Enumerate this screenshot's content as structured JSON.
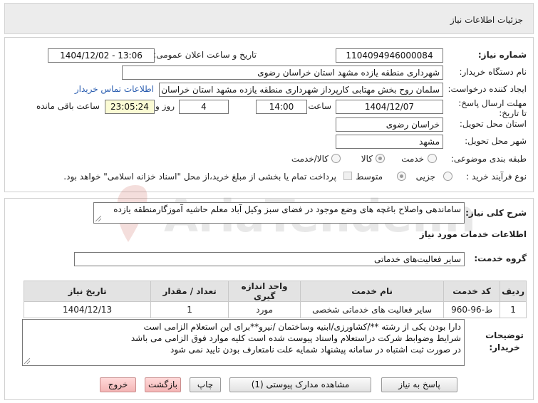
{
  "header": {
    "title": "جزئیات اطلاعات نیاز"
  },
  "fields": {
    "need_number": {
      "label": "شماره نیاز:",
      "value": "1104094946000084"
    },
    "announce_datetime": {
      "label": "تاریخ و ساعت اعلان عمومی:",
      "value": "1404/12/02 - 13:06"
    },
    "buyer_org": {
      "label": "نام دستگاه خریدار:",
      "value": "شهرداری منطقه یازده مشهد استان خراسان رضوی"
    },
    "requester": {
      "label": "ایجاد کننده درخواست:",
      "value": "سلمان روح بخش مهتابی کارپرداز شهرداری منطقه یازده مشهد استان خراسان ر",
      "contact_link": "اطلاعات تماس خریدار"
    },
    "deadline": {
      "label": "مهلت ارسال پاسخ: تا تاریخ:",
      "date": "1404/12/07",
      "time_label": "ساعت",
      "time": "14:00",
      "days": "4",
      "days_label": "روز و",
      "remaining": "23:05:24",
      "remaining_label": "ساعت باقی مانده"
    },
    "delivery_province": {
      "label": "استان محل تحویل:",
      "value": "خراسان رضوی"
    },
    "delivery_city": {
      "label": "شهر محل تحویل:",
      "value": "مشهد"
    },
    "category": {
      "label": "طبقه بندی موضوعی:",
      "options": [
        "کالا",
        "خدمت",
        "کالا/خدمت"
      ],
      "selected": "خدمت"
    },
    "purchase_type": {
      "label": "نوع فرآیند خرید :",
      "options": [
        "جزیی",
        "متوسط"
      ],
      "selected": "متوسط",
      "payment_note": "پرداخت تمام یا بخشی از مبلغ خرید،از محل \"اسناد خزانه اسلامی\" خواهد بود."
    }
  },
  "summary": {
    "label": "شرح کلی نیاز:",
    "value": "ساماندهی واصلاح باغچه های وضع موجود در فضای سبز وکیل آباد معلم حاشیه آموزگارمنطقه یازده"
  },
  "services_section": {
    "title": "اطلاعات خدمات مورد نیاز"
  },
  "service_group": {
    "label": "گروه خدمت:",
    "value": "سایر فعالیت‌های خدماتی"
  },
  "table": {
    "headers": [
      "ردیف",
      "کد خدمت",
      "نام خدمت",
      "واحد اندازه گیری",
      "تعداد / مقدار",
      "تاریخ نیاز"
    ],
    "rows": [
      [
        "1",
        "ط-96-960",
        "سایر فعالیت های خدماتی شخصی",
        "مورد",
        "1",
        "1404/12/13"
      ]
    ]
  },
  "buyer_notes": {
    "label": "توضیحات خریدار:",
    "lines": [
      "دارا بودن یکی از رشته **/کشاورزی/ابنیه وساختمان /نیرو**برای این استعلام الزامی است",
      " شرایط وضوابط شرکت دراستعلام واسناد پیوست شده است کلیه موارد فوق الزامی می باشد",
      "در صورت ثبت اشتباه در سامانه پیشنهاد شمایه علت نامتعارف بودن تایید نمی شود"
    ]
  },
  "buttons": {
    "reply": "پاسخ به نیاز",
    "attachments": "مشاهده مدارک پیوستی (1)",
    "print": "چاپ",
    "back": "بازگشت",
    "exit": "خروج"
  },
  "watermark": {
    "text": "AriaTender.net"
  },
  "colors": {
    "link": "#2a5db0",
    "highlight": "#fbfbd4",
    "header_bg": "#ececec",
    "pink_button": "#f4b5b5"
  }
}
